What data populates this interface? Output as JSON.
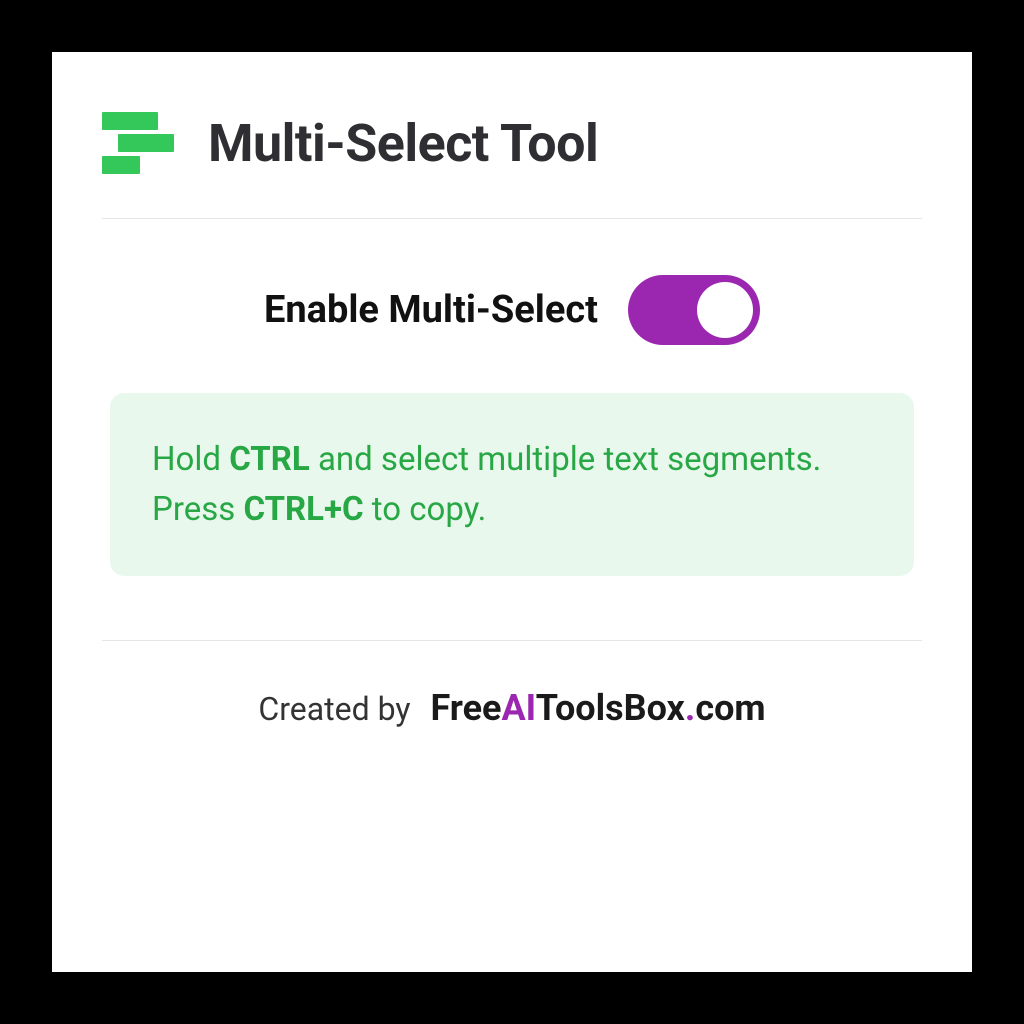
{
  "header": {
    "title": "Multi-Select Tool"
  },
  "toggle": {
    "label": "Enable Multi-Select",
    "state": "on"
  },
  "info": {
    "seg1": "Hold ",
    "kbd1": "CTRL",
    "seg2": " and select multiple text segments. Press ",
    "kbd2": "CTRL+C",
    "seg3": " to copy."
  },
  "footer": {
    "prefix": "Created by",
    "brand_pre": "Free",
    "brand_accent": "AI",
    "brand_post": "ToolsBox",
    "brand_dot": ".",
    "brand_tld": "com"
  },
  "colors": {
    "toggle_on": "#9b27b0",
    "logo_green": "#34c759",
    "info_bg": "#e9f8ed",
    "info_text": "#28a745"
  }
}
